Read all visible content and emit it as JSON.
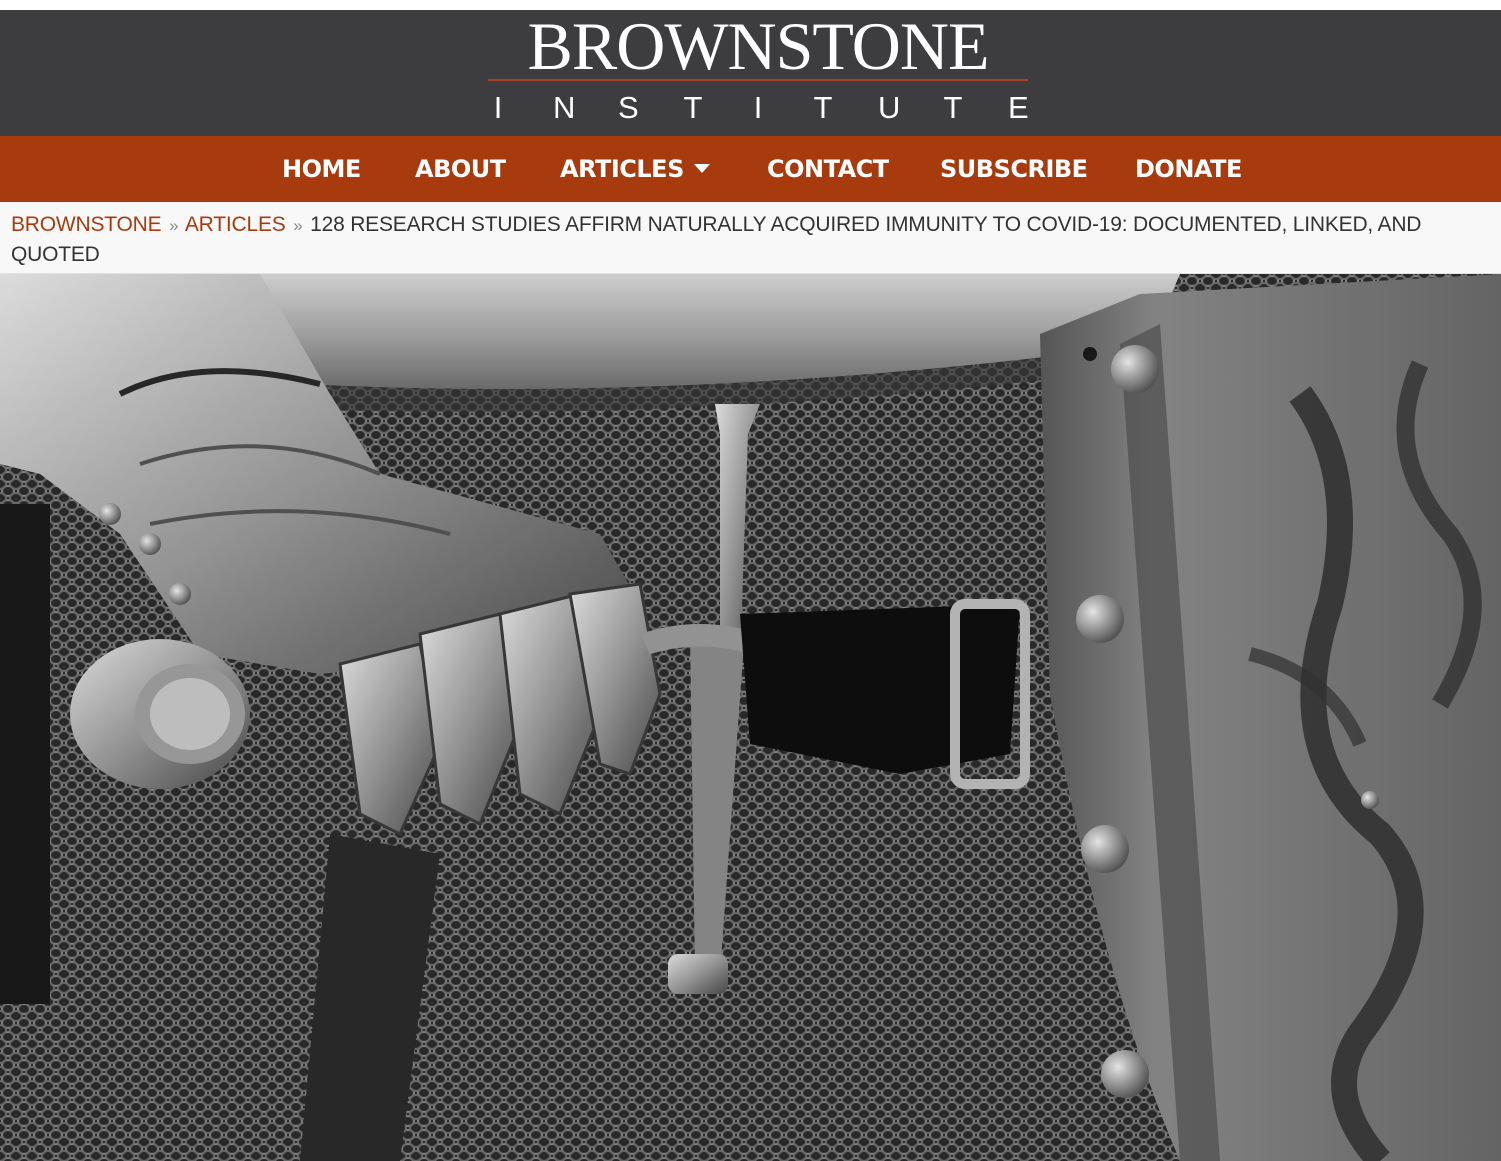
{
  "site": {
    "logo_main": "BROWNSTONE",
    "logo_sub": [
      "I",
      "N",
      "S",
      "T",
      "I",
      "T",
      "U",
      "T",
      "E"
    ]
  },
  "nav": {
    "items": [
      {
        "label": "HOME"
      },
      {
        "label": "ABOUT"
      },
      {
        "label": "ARTICLES",
        "has_dropdown": true
      },
      {
        "label": "CONTACT"
      },
      {
        "label": "SUBSCRIBE"
      },
      {
        "label": "DONATE"
      }
    ]
  },
  "breadcrumb": {
    "home": "BROWNSTONE",
    "section": "ARTICLES",
    "separator": "»",
    "current": "128 RESEARCH STUDIES AFFIRM NATURALLY ACQUIRED IMMUNITY TO COVID-19: DOCUMENTED, LINKED, AND QUOTED"
  },
  "hero": {
    "icon": "armored-knight-photo"
  },
  "colors": {
    "header_bg": "#3d3d3f",
    "nav_bg": "#a83b0e",
    "accent": "#a83b0e",
    "logo_rule": "#a8432a"
  }
}
